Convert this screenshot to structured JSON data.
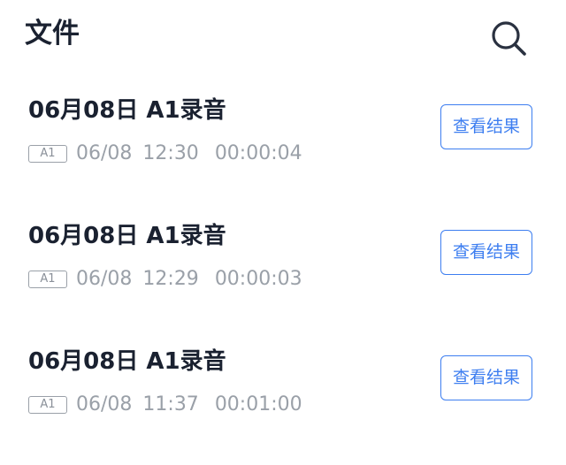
{
  "header": {
    "title": "文件",
    "search_icon": "search-icon"
  },
  "files": [
    {
      "title": "06月08日 A1录音",
      "badge": "A1",
      "date": "06/08",
      "time": "12:30",
      "duration": "00:00:04",
      "action_label": "查看结果"
    },
    {
      "title": "06月08日 A1录音",
      "badge": "A1",
      "date": "06/08",
      "time": "12:29",
      "duration": "00:00:03",
      "action_label": "查看结果"
    },
    {
      "title": "06月08日 A1录音",
      "badge": "A1",
      "date": "06/08",
      "time": "11:37",
      "duration": "00:01:00",
      "action_label": "查看结果"
    }
  ],
  "colors": {
    "accent": "#3d7ef0",
    "title_text": "#1a2130",
    "meta_text": "#9aa0a8"
  }
}
